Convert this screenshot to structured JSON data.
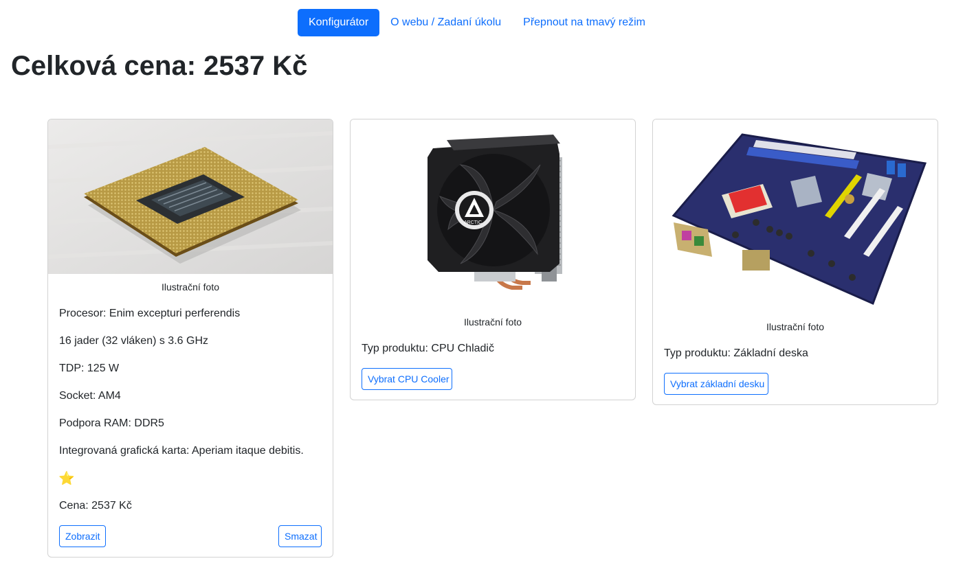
{
  "nav": {
    "items": [
      {
        "label": "Konfigurátor",
        "active": true
      },
      {
        "label": "O webu / Zadaní úkolu",
        "active": false
      },
      {
        "label": "Přepnout na tmavý režim",
        "active": false
      }
    ]
  },
  "total": {
    "text": "Celková cena: 2537 Kč"
  },
  "cards": {
    "cpu": {
      "caption": "Ilustrační foto",
      "name": "Procesor: Enim excepturi perferendis",
      "cores": "16 jader (32 vláken) s 3.6 GHz",
      "tdp": "TDP: 125 W",
      "socket": "Socket: AM4",
      "ram": "Podpora RAM: DDR5",
      "igpu": "Integrovaná grafická karta: Aperiam itaque debitis.",
      "star": "⭐",
      "price": "Cena: 2537 Kč",
      "show_label": "Zobrazit",
      "delete_label": "Smazat"
    },
    "cooler": {
      "caption": "Ilustrační foto",
      "type": "Typ produktu: CPU Chladič",
      "select_label": "Vybrat CPU Cooler",
      "brand_mark": "ARCTIC"
    },
    "motherboard": {
      "caption": "Ilustrační foto",
      "type": "Typ produktu: Základní deska",
      "select_label": "Vybrat základní desku"
    }
  },
  "colors": {
    "accent": "#0d6efd",
    "text": "#212529"
  }
}
